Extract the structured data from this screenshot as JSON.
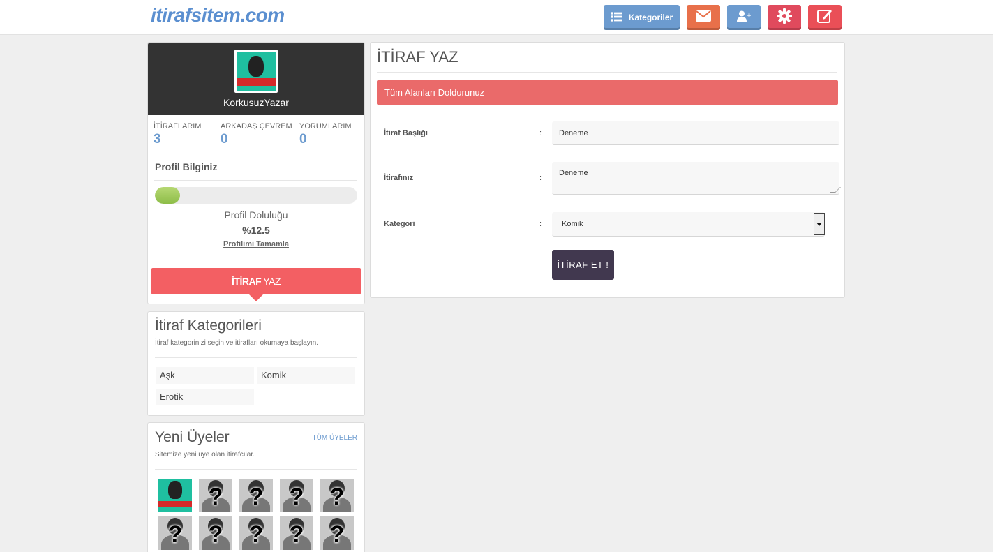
{
  "header": {
    "logo": "itirafsitem.com",
    "categories_label": "Kategoriler",
    "icons": [
      "list-icon",
      "mail-icon",
      "add-user-icon",
      "gear-icon",
      "edit-icon"
    ],
    "colors": {
      "categories": "#6c9bcf",
      "mail": "#e8704a",
      "user": "#6c9bcf",
      "gear": "#e04a5d",
      "edit": "#ea4f57"
    }
  },
  "profile": {
    "username": "KorkusuzYazar",
    "stats": [
      {
        "label": "İTİRAFLARIM",
        "value": "3"
      },
      {
        "label": "ARKADAŞ ÇEVREM",
        "value": "0"
      },
      {
        "label": "YORUMLARIM",
        "value": "0"
      }
    ],
    "info_title": "Profil Bilginiz",
    "completion_label": "Profil Doluluğu",
    "completion_value": "%12.5",
    "completion_fraction": 0.125,
    "complete_link": "Profilimi Tamamla",
    "write_btn_bold": "İTİRAF",
    "write_btn_rest": " YAZ"
  },
  "categories": {
    "title": "İtiraf Kategorileri",
    "subtitle": "İtiraf kategorinizi seçin ve itirafları okumaya başlayın.",
    "items": [
      "Aşk",
      "Komik",
      "Erotik"
    ]
  },
  "members": {
    "title": "Yeni Üyeler",
    "subtitle": "Sitemize yeni üye olan itirafcılar.",
    "all_link": "TÜM ÜYELER",
    "placeholder_mark": "?"
  },
  "form": {
    "title": "İTİRAF YAZ",
    "alert": "Tüm Alanları Doldurunuz",
    "colon": ":",
    "fields": {
      "title_label": "İtiraf Başlığı",
      "title_value": "Deneme",
      "body_label": "İtirafınız",
      "body_value": "Deneme",
      "category_label": "Kategori",
      "category_value": "Komik"
    },
    "submit": "İTİRAF ET !"
  }
}
